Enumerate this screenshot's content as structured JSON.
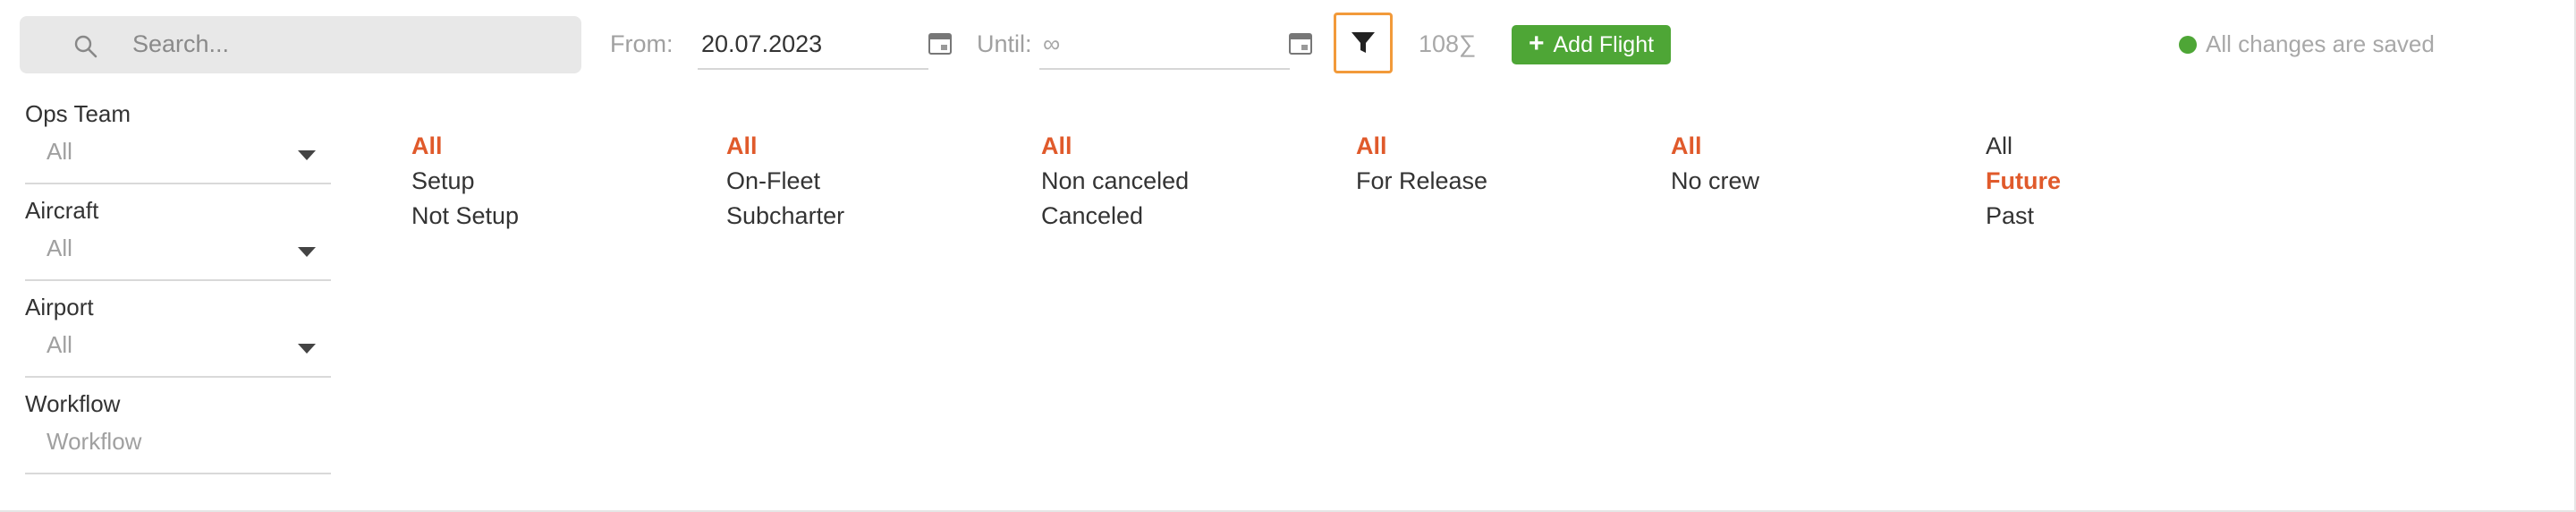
{
  "search": {
    "placeholder": "Search..."
  },
  "date_range": {
    "from_label": "From:",
    "from_value": "20.07.2023",
    "until_label": "Until:",
    "until_value": "∞"
  },
  "count_label": "108∑",
  "add_flight_label": "Add Flight",
  "save_status": "All changes are saved",
  "colors": {
    "accent": "#e05a2b",
    "brand_green": "#4ea636",
    "filter_border": "#f29a3a"
  },
  "sidebar": [
    {
      "label": "Ops Team",
      "value": "All",
      "dropdown": true
    },
    {
      "label": "Aircraft",
      "value": "All",
      "dropdown": true
    },
    {
      "label": "Airport",
      "value": "All",
      "dropdown": true
    },
    {
      "label": "Workflow",
      "value": "Workflow",
      "dropdown": false
    }
  ],
  "filter_groups": [
    {
      "options": [
        {
          "label": "All",
          "active": true
        },
        {
          "label": "Setup",
          "active": false
        },
        {
          "label": "Not Setup",
          "active": false
        }
      ]
    },
    {
      "options": [
        {
          "label": "All",
          "active": true
        },
        {
          "label": "On-Fleet",
          "active": false
        },
        {
          "label": "Subcharter",
          "active": false
        }
      ]
    },
    {
      "options": [
        {
          "label": "All",
          "active": true
        },
        {
          "label": "Non canceled",
          "active": false
        },
        {
          "label": "Canceled",
          "active": false
        }
      ]
    },
    {
      "options": [
        {
          "label": "All",
          "active": true
        },
        {
          "label": "For Release",
          "active": false
        }
      ]
    },
    {
      "options": [
        {
          "label": "All",
          "active": true
        },
        {
          "label": "No crew",
          "active": false
        }
      ]
    },
    {
      "options": [
        {
          "label": "All",
          "active": false
        },
        {
          "label": "Future",
          "active": true
        },
        {
          "label": "Past",
          "active": false
        }
      ]
    }
  ]
}
